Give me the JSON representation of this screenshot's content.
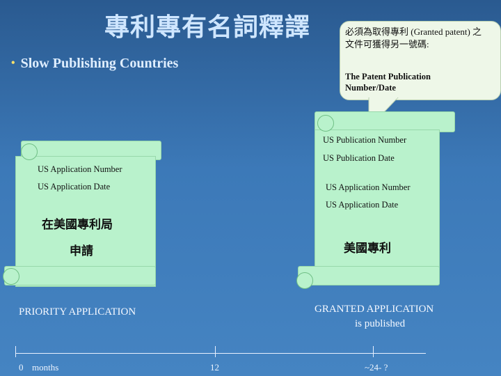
{
  "title": "專利專有名詞釋譯",
  "bullet": "Slow Publishing Countries",
  "callout": {
    "text": "必須為取得專利 (Granted patent) 之文件可獲得另一號碼:",
    "sub": "The Patent Publication Number/Date"
  },
  "left_scroll": {
    "app_number": "US Application Number",
    "app_date": "US Application Date",
    "cjk1": "在美國專利局",
    "cjk2": "申請"
  },
  "right_scroll": {
    "pub_number": "US  Publication Number",
    "pub_date": "US  Publication Date",
    "app_number": "US Application Number",
    "app_date": "US Application Date",
    "cjk": "美國專利"
  },
  "priority_label": "PRIORITY APPLICATION",
  "granted_label": "GRANTED APPLICATION",
  "granted_sub": "is published",
  "timeline": {
    "start": "0",
    "unit": "months",
    "mid": "12",
    "end": "~24- ?"
  }
}
